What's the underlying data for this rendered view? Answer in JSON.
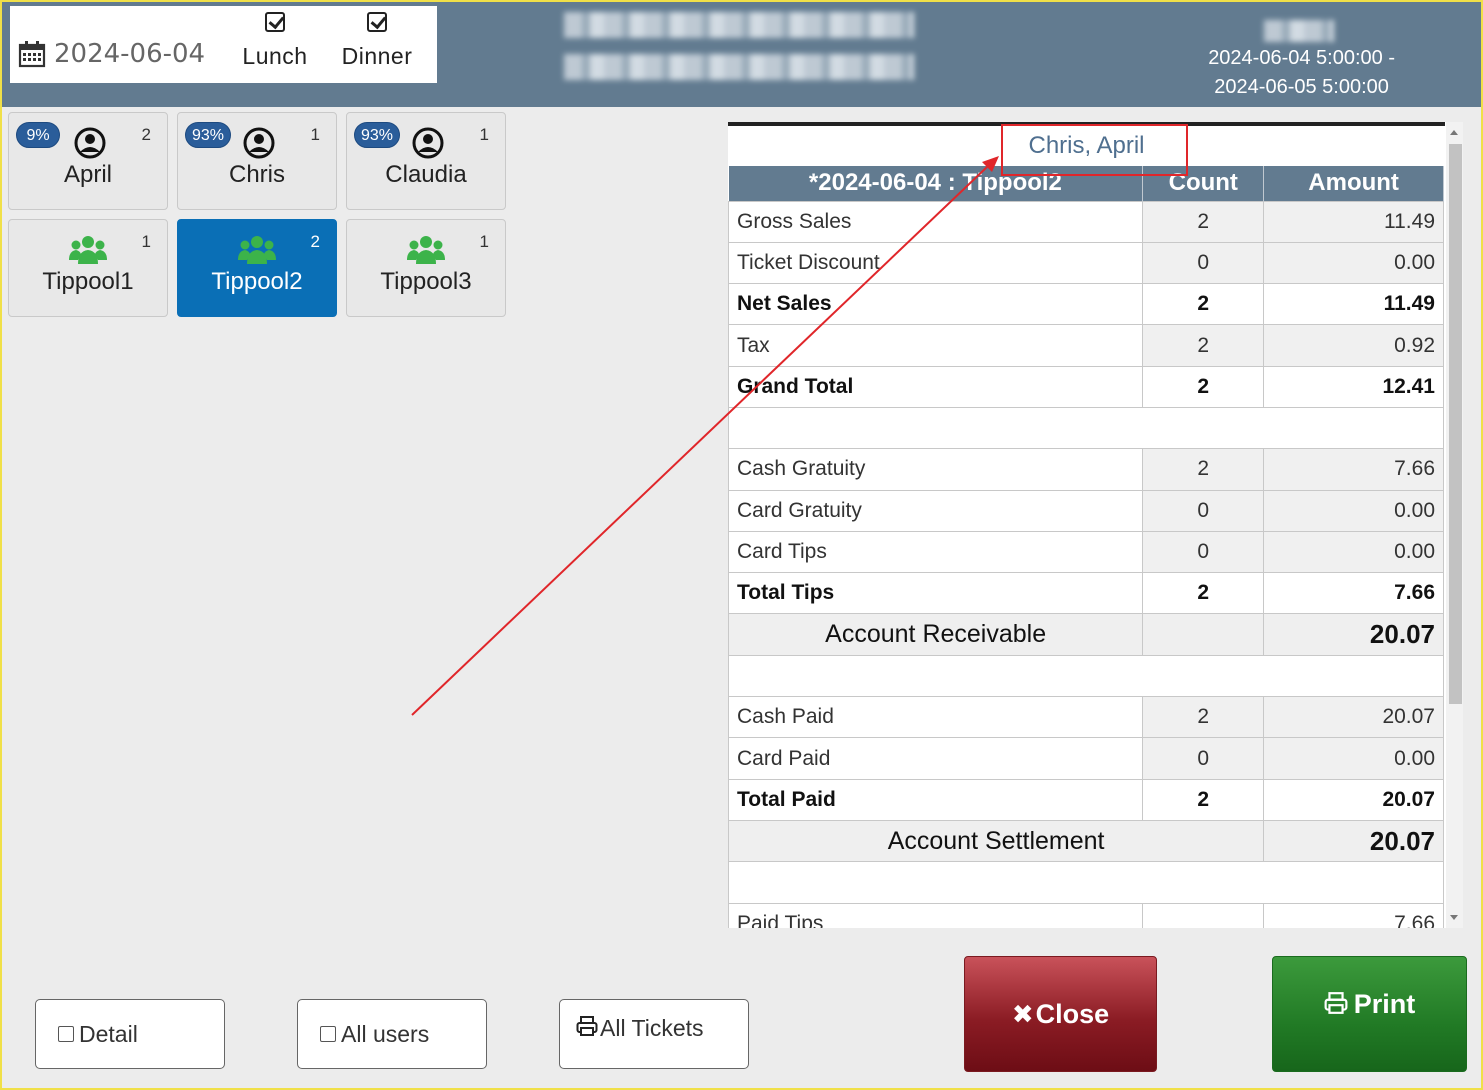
{
  "header": {
    "date": "2024-06-04",
    "meals": [
      {
        "label": "Lunch",
        "checked": true
      },
      {
        "label": "Dinner",
        "checked": true
      }
    ],
    "range_line1": "2024-06-04 5:00:00 -",
    "range_line2": "2024-06-05 5:00:00"
  },
  "employees": [
    {
      "badge": "9%",
      "count": "2",
      "name": "April"
    },
    {
      "badge": "93%",
      "count": "1",
      "name": "Chris"
    },
    {
      "badge": "93%",
      "count": "1",
      "name": "Claudia"
    }
  ],
  "tippools": [
    {
      "count": "1",
      "name": "Tippool1"
    },
    {
      "count": "2",
      "name": "Tippool2",
      "active": true
    },
    {
      "count": "1",
      "name": "Tippool3"
    }
  ],
  "report": {
    "title": "Chris, April",
    "header": {
      "label": "*2024-06-04 : Tippool2",
      "count": "Count",
      "amount": "Amount"
    },
    "rows": [
      {
        "label": "Gross Sales",
        "count": "2",
        "amount": "11.49"
      },
      {
        "label": "Ticket Discount",
        "count": "0",
        "amount": "0.00"
      },
      {
        "label": "Net Sales",
        "count": "2",
        "amount": "11.49"
      },
      {
        "label": "Tax",
        "count": "2",
        "amount": "0.92"
      },
      {
        "label": "Grand Total",
        "count": "2",
        "amount": "12.41"
      },
      {
        "label": "Cash Gratuity",
        "count": "2",
        "amount": "7.66"
      },
      {
        "label": "Card Gratuity",
        "count": "0",
        "amount": "0.00"
      },
      {
        "label": "Card Tips",
        "count": "0",
        "amount": "0.00"
      },
      {
        "label": "Total Tips",
        "count": "2",
        "amount": "7.66"
      },
      {
        "label": "Account Receivable",
        "amount": "20.07"
      },
      {
        "label": "Cash Paid",
        "count": "2",
        "amount": "20.07"
      },
      {
        "label": "Card Paid",
        "count": "0",
        "amount": "0.00"
      },
      {
        "label": "Total Paid",
        "count": "2",
        "amount": "20.07"
      },
      {
        "label": "Account Settlement",
        "amount": "20.07"
      },
      {
        "label": "Paid Tips",
        "count": "",
        "amount": "7.66"
      }
    ]
  },
  "buttons": {
    "detail": "Detail",
    "all_users": "All users",
    "all_tickets": "All Tickets",
    "close": "Close",
    "print": "Print"
  },
  "colors": {
    "header_bg": "#627b90",
    "active_tile": "#0a6fb6",
    "group_icon": "#3cb34a",
    "annotation": "#e0262a"
  }
}
